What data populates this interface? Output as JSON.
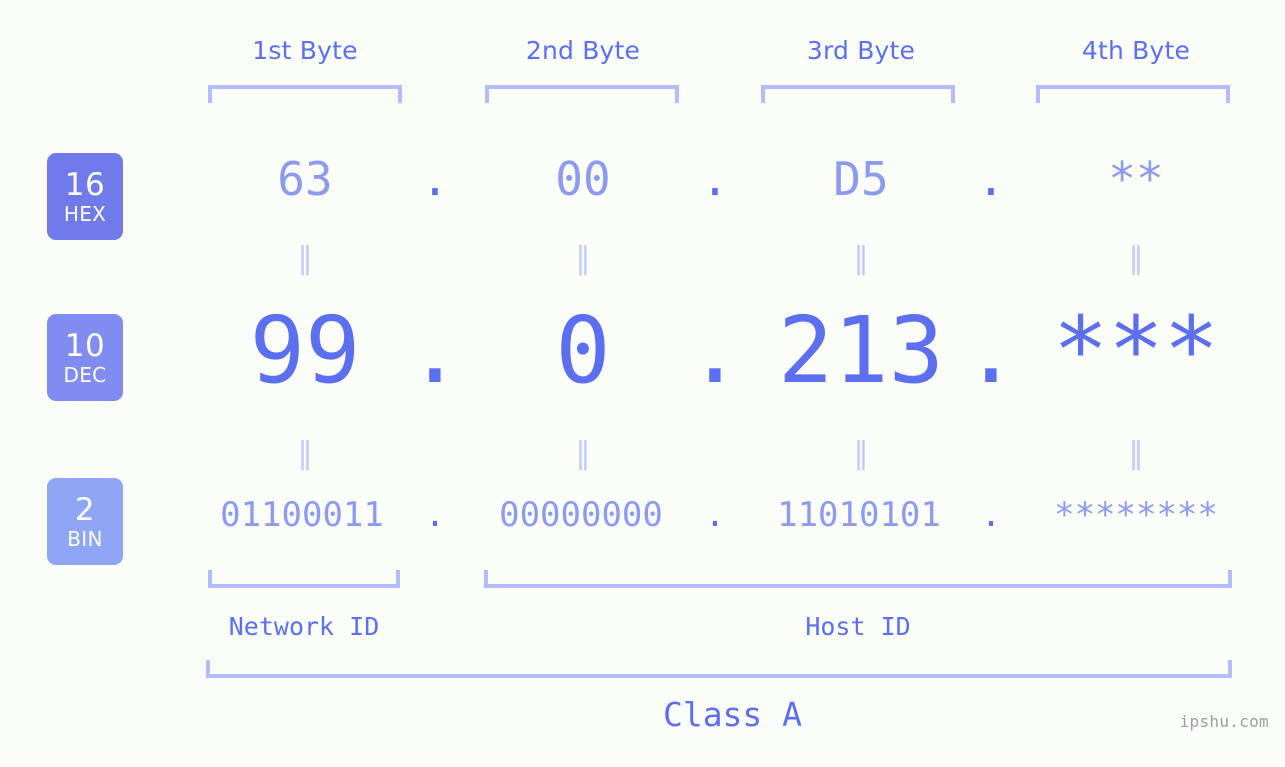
{
  "meta": {
    "watermark": "ipshu.com"
  },
  "columns": [
    {
      "header": "1st Byte"
    },
    {
      "header": "2nd Byte"
    },
    {
      "header": "3rd Byte"
    },
    {
      "header": "4th Byte"
    }
  ],
  "bases": [
    {
      "number": "16",
      "abbr": "HEX"
    },
    {
      "number": "10",
      "abbr": "DEC"
    },
    {
      "number": "2",
      "abbr": "BIN"
    }
  ],
  "rows": {
    "hex": {
      "values": [
        "63",
        "00",
        "D5",
        "**"
      ]
    },
    "dec": {
      "values": [
        "99",
        "0",
        "213",
        "***"
      ]
    },
    "bin": {
      "values": [
        "01100011",
        "00000000",
        "11010101",
        "********"
      ]
    }
  },
  "separators": {
    "dot": ".",
    "equals": "‖"
  },
  "segments": {
    "network_id": "Network ID",
    "host_id": "Host ID"
  },
  "class_label": "Class A",
  "colors": {
    "background": "#fbfdf8",
    "accent_strong": "#5b6ff0",
    "accent_light": "#8c9bf2",
    "bracket": "#b3bdfb",
    "equals": "#c3cbfa",
    "badge_hex": "#707ae8",
    "badge_dec": "#818cf0",
    "badge_bin": "#8fa5f5",
    "watermark": "#9aa0a6"
  }
}
